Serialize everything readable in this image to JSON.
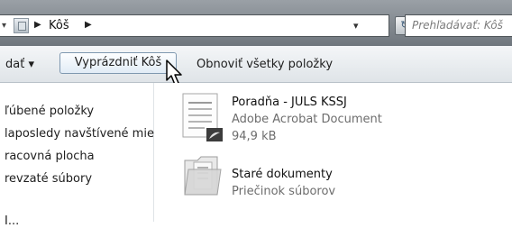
{
  "address": {
    "breadcrumb": "Kôš",
    "search_placeholder": "Prehľadávať: Kôš"
  },
  "toolbar": {
    "organize_label": "dať ▾",
    "empty_label": "Vyprázdniť Kôš",
    "restore_label": "Obnoviť všetky položky"
  },
  "nav": {
    "items": [
      "ľúbené položky",
      "laposledy navštívené mie",
      "racovná plocha",
      "revzaté súbory",
      "I..."
    ]
  },
  "files": [
    {
      "name": "Poradňa - JULS KSSJ",
      "type": "Adobe Acrobat Document",
      "size": "94,9 kB",
      "icon": "pdf-document-icon"
    },
    {
      "name": "Staré dokumenty",
      "type": "Priečinok súborov",
      "icon": "folder-icon"
    }
  ]
}
